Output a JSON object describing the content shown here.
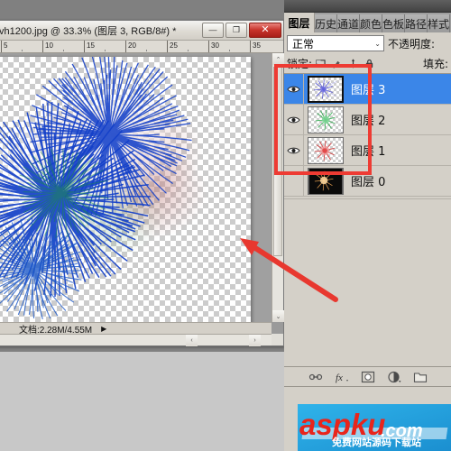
{
  "document_window": {
    "title": "vh1200.jpg @ 33.3% (图层 3, RGB/8#) *",
    "window_buttons": {
      "minimize": "—",
      "maximize": "❐",
      "close": "✕"
    },
    "ruler": {
      "unit_ticks": [
        "5",
        "10",
        "15",
        "20",
        "25",
        "30",
        "35"
      ]
    },
    "status": {
      "document_size": "文档:2.28M/4.55M",
      "expand_caret": "▶"
    },
    "scroll": {
      "up_arrow": "⌃",
      "down_arrow": "⌄",
      "left_arrow": "‹",
      "right_arrow": "›"
    }
  },
  "panel": {
    "tabs": [
      {
        "label": "图层",
        "active": true
      },
      {
        "label": "历史",
        "active": false
      },
      {
        "label": "通道",
        "active": false
      },
      {
        "label": "颜色",
        "active": false
      },
      {
        "label": "色板",
        "active": false
      },
      {
        "label": "路径",
        "active": false
      },
      {
        "label": "样式",
        "active": false
      }
    ],
    "blend_mode": {
      "value": "正常",
      "caret": "⌄"
    },
    "opacity_label": "不透明度:",
    "lock_label": "锁定:",
    "fill_label": "填充:",
    "layers": [
      {
        "name": "图层 3",
        "visible": true,
        "selected": true,
        "thumb_color": "#3a3ad0",
        "thumb_color2": "#8f8fe8"
      },
      {
        "name": "图层 2",
        "visible": true,
        "selected": false,
        "thumb_color": "#22aa44",
        "thumb_color2": "#7fd898"
      },
      {
        "name": "图层 1",
        "visible": true,
        "selected": false,
        "thumb_color": "#d03434",
        "thumb_color2": "#f09a9a"
      },
      {
        "name": "图层 0",
        "visible": false,
        "selected": false,
        "thumb_color": "#e8a050",
        "thumb_color2": "#000000"
      }
    ],
    "footer_icons": [
      "link-icon",
      "fx-icon",
      "mask-icon",
      "adjustment-icon",
      "group-folder-icon"
    ]
  },
  "annotations": {
    "highlight_rect_color": "#ee3b33",
    "arrow_color": "#e8382f"
  },
  "watermark": {
    "main_text": "aspku",
    "suffix_text": ".com",
    "sub_text": "免费网站源码下载站",
    "main_color": "#e8251c",
    "suffix_color": "#ffffff",
    "bg_color": "#29a8e0"
  },
  "canvas": {
    "artwork_description": "blue-firework-burst",
    "burst_color_primary": "#1340c8",
    "burst_color_secondary": "#1a8a4a",
    "burst_color_faint": "#c08080"
  }
}
